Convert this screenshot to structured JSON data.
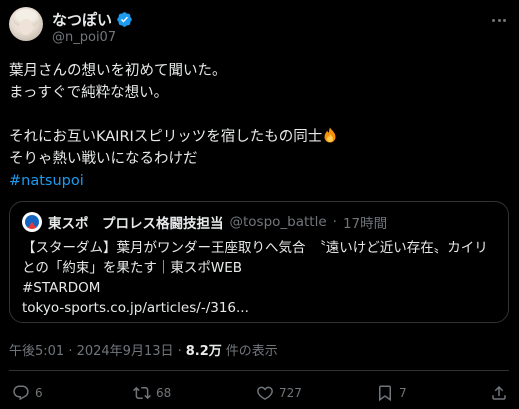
{
  "post": {
    "display_name": "なつぽい",
    "handle": "@n_poi07",
    "text_lines": [
      "葉月さんの想いを初めて聞いた。",
      "まっすぐで純粋な想い。",
      "",
      "それにお互いKAIRIスピリッツを宿したもの同士",
      "そりゃ熱い戦いになるわけだ"
    ],
    "hashtag": "#natsupoi"
  },
  "quote": {
    "name": "東スポ　プロレス格闘技担当",
    "handle": "@tospo_battle",
    "separator": "·",
    "time": "17時間",
    "body_lines": [
      "【スターダム】葉月がワンダー王座取りへ気合　〝遠いけど近い存在〟カイリ",
      "との「約束」を果たす｜東スポWEB",
      "#STARDOM",
      " tokyo-sports.co.jp/articles/-/316..."
    ]
  },
  "timestamp": {
    "time": "午後5:01 · 2024年9月13日 ·",
    "views": "8.2万",
    "views_suffix": "件の表示"
  },
  "actions": {
    "reply_count": "6",
    "repost_count": "68",
    "like_count": "727",
    "bookmark_count": "7"
  },
  "colors": {
    "background": "#000000",
    "text": "#e7e9ea",
    "muted": "#71767b",
    "accent": "#1d9bf0",
    "border": "#2f3336"
  },
  "icons": [
    "verified-badge-icon",
    "more-icon",
    "fire-emoji-icon",
    "reply-icon",
    "repost-icon",
    "like-icon",
    "bookmark-icon",
    "share-icon"
  ]
}
